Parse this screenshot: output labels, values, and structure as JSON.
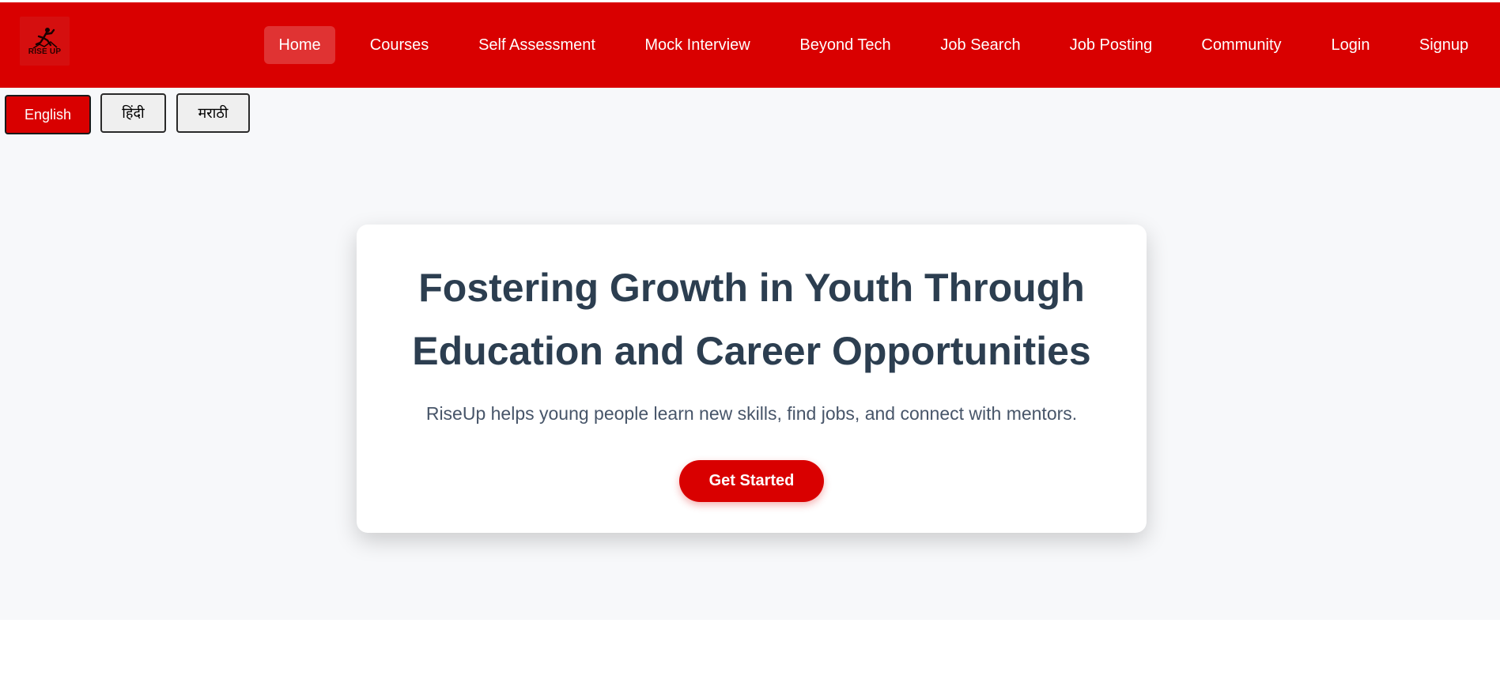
{
  "brand": {
    "logo_text": "RISE UP",
    "logo_icon": "climbing-figure-icon",
    "primary_color": "#d90000"
  },
  "nav": {
    "items": [
      {
        "label": "Home",
        "active": true
      },
      {
        "label": "Courses"
      },
      {
        "label": "Self Assessment"
      },
      {
        "label": "Mock Interview"
      },
      {
        "label": "Beyond Tech"
      },
      {
        "label": "Job Search"
      },
      {
        "label": "Job Posting"
      },
      {
        "label": "Community"
      },
      {
        "label": "Login"
      },
      {
        "label": "Signup"
      }
    ]
  },
  "languages": {
    "selected": "English",
    "options": [
      "English",
      "हिंदी",
      "मराठी"
    ]
  },
  "hero": {
    "title_line1": "Fostering Growth in Youth Through",
    "title_line2": "Education and Career Opportunities",
    "subtitle": "RiseUp helps young people learn new skills, find jobs, and connect with mentors.",
    "cta_label": "Get Started"
  }
}
